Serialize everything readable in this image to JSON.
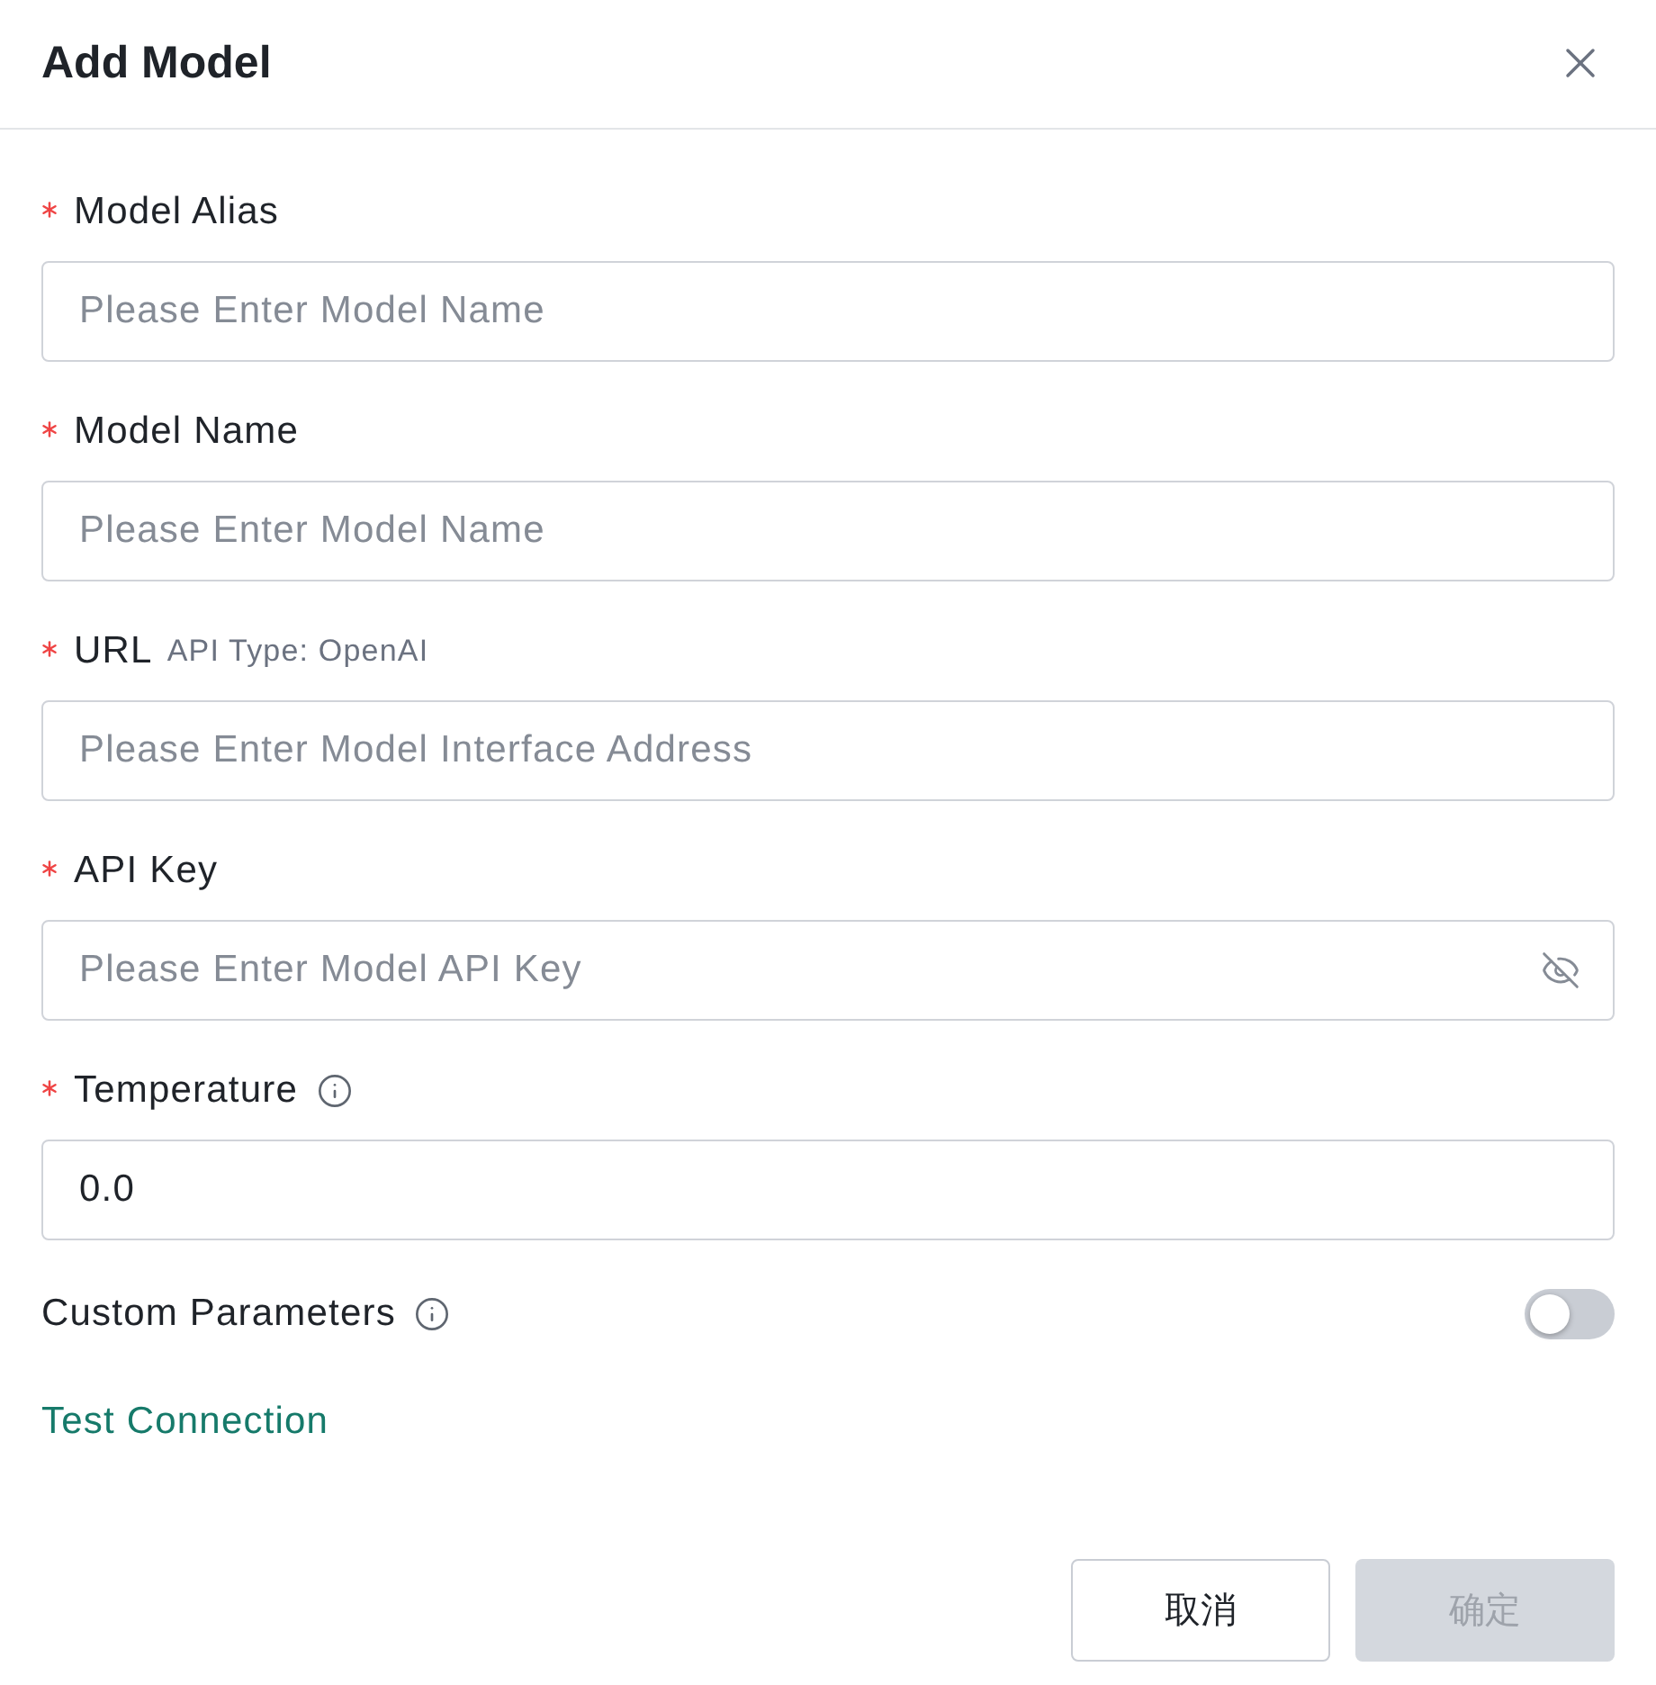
{
  "dialog": {
    "title": "Add Model"
  },
  "fields": [
    {
      "label": "Model Alias",
      "required": true,
      "info": false,
      "kind": "text",
      "placeholder": "Please Enter Model Name"
    },
    {
      "label": "Model Name",
      "required": true,
      "info": false,
      "kind": "text",
      "placeholder": "Please Enter Model Name"
    },
    {
      "label": "URL",
      "required": true,
      "info": false,
      "hint": "API Type: OpenAI",
      "kind": "text",
      "placeholder": "Please Enter Model Interface Address"
    },
    {
      "label": "API Key",
      "required": true,
      "info": false,
      "kind": "password",
      "placeholder": "Please Enter Model API Key"
    },
    {
      "label": "Temperature",
      "required": true,
      "info": true,
      "kind": "text",
      "value": "0.0"
    }
  ],
  "custom_parameters": {
    "label": "Custom Parameters",
    "info": true,
    "on": false
  },
  "test_connection": {
    "label": "Test Connection"
  },
  "buttons": [
    {
      "label": "取消",
      "kind": "secondary",
      "disabled": false
    },
    {
      "label": "确定",
      "kind": "primary",
      "disabled": true
    }
  ]
}
